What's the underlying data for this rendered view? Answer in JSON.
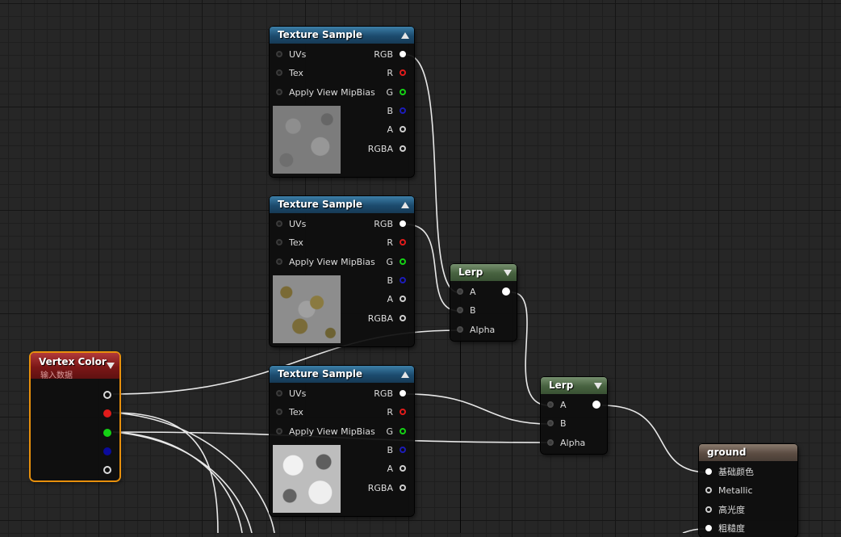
{
  "nodes": {
    "tex1": {
      "title": "Texture Sample",
      "inputs": [
        "UVs",
        "Tex",
        "Apply View MipBias"
      ],
      "outputs": [
        "RGB",
        "R",
        "G",
        "B",
        "A",
        "RGBA"
      ]
    },
    "tex2": {
      "title": "Texture Sample",
      "inputs": [
        "UVs",
        "Tex",
        "Apply View MipBias"
      ],
      "outputs": [
        "RGB",
        "R",
        "G",
        "B",
        "A",
        "RGBA"
      ]
    },
    "tex3": {
      "title": "Texture Sample",
      "inputs": [
        "UVs",
        "Tex",
        "Apply View MipBias"
      ],
      "outputs": [
        "RGB",
        "R",
        "G",
        "B",
        "A",
        "RGBA"
      ]
    },
    "lerp1": {
      "title": "Lerp",
      "inputs": [
        "A",
        "B",
        "Alpha"
      ]
    },
    "lerp2": {
      "title": "Lerp",
      "inputs": [
        "A",
        "B",
        "Alpha"
      ]
    },
    "vertex_color": {
      "title": "Vertex Color",
      "subtitle": "输入数据"
    },
    "material": {
      "title": "ground",
      "inputs": [
        "基础颜色",
        "Metallic",
        "高光度",
        "粗糙度"
      ]
    }
  },
  "colors": {
    "texture_header": "#1c4b6e",
    "lerp_header": "#47623f",
    "material_header": "#5b4c42",
    "vertex_color_header": "#7c1717",
    "selection_outline": "#e8900c",
    "pin_r": "#e01b1b",
    "pin_g": "#14d114",
    "pin_b": "#1c1cb8"
  },
  "icons": [
    "collapse-arrow-up-icon",
    "collapse-arrow-down-icon",
    "pin-icon"
  ]
}
